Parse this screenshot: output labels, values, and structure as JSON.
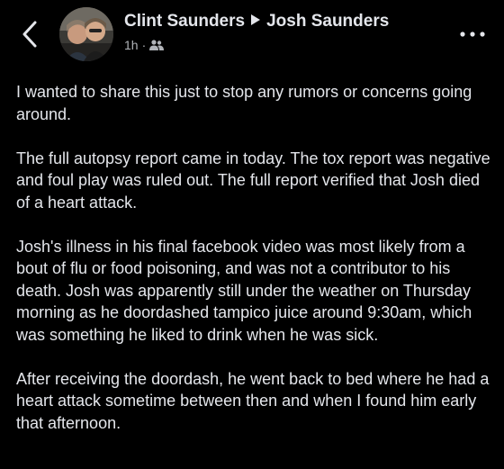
{
  "header": {
    "back_icon": "chevron-left-icon",
    "author": "Clint Saunders",
    "separator_icon": "arrow-right-icon",
    "recipient": "Josh Saunders",
    "timestamp": "1h",
    "dot": "·",
    "audience_icon": "friends-icon",
    "more_icon": "more-horizontal-icon"
  },
  "post": {
    "paragraphs": [
      "I wanted to share this just to stop any rumors or concerns going around.",
      "The full autopsy report came in today.  The tox report was negative and foul play was ruled out. The full report verified that Josh died of a heart attack.",
      "Josh's illness in his final facebook video was most likely from a bout of flu or food poisoning, and was not a contributor to his death. Josh was apparently still under the weather on Thursday morning as he doordashed tampico juice around 9:30am, which was something he liked to drink when he was sick.",
      "After receiving the doordash, he went back to bed where he had a heart attack sometime between then and when I found him early that afternoon."
    ]
  },
  "colors": {
    "background": "#000000",
    "text_primary": "#e4e6eb",
    "text_secondary": "#b0b3b8"
  }
}
